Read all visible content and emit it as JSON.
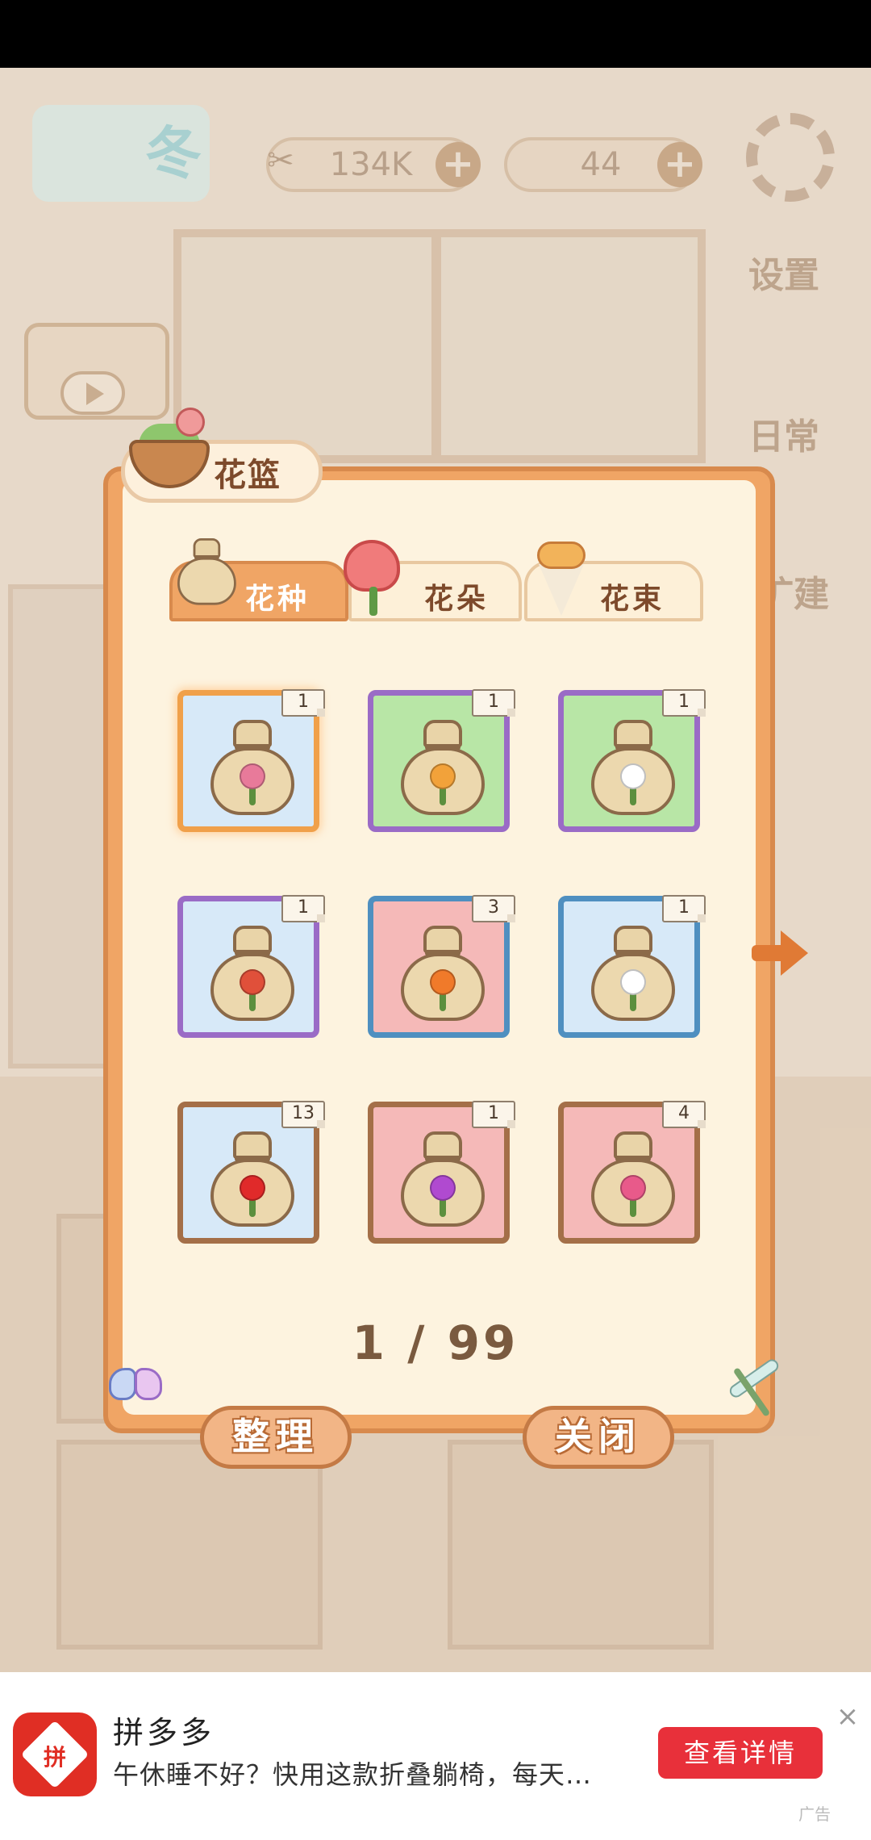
{
  "hud": {
    "season_label": "冬",
    "fish_value": "134K",
    "cheese_value": "44",
    "settings_label": "设置",
    "daily_label": "日常",
    "build_label": "扩建"
  },
  "dialog": {
    "title": "花篮",
    "tabs": [
      {
        "label": "花种",
        "active": true
      },
      {
        "label": "花朵",
        "active": false
      },
      {
        "label": "花束",
        "active": false
      }
    ],
    "slots": [
      {
        "count": "1",
        "frame": "orange",
        "bg": "blue",
        "flower_color": "#e87a9a"
      },
      {
        "count": "1",
        "frame": "purple",
        "bg": "green",
        "flower_color": "#f2a23a"
      },
      {
        "count": "1",
        "frame": "purple",
        "bg": "green",
        "flower_color": "#ffffff"
      },
      {
        "count": "1",
        "frame": "purple",
        "bg": "blue",
        "flower_color": "#e0503a"
      },
      {
        "count": "3",
        "frame": "blue",
        "bg": "pink",
        "flower_color": "#f07a2a"
      },
      {
        "count": "1",
        "frame": "blue",
        "bg": "blue",
        "flower_color": "#ffffff"
      },
      {
        "count": "13",
        "frame": "brown",
        "bg": "blue",
        "flower_color": "#e02a2a"
      },
      {
        "count": "1",
        "frame": "brown",
        "bg": "pink",
        "flower_color": "#b04ad0"
      },
      {
        "count": "4",
        "frame": "brown",
        "bg": "pink",
        "flower_color": "#e85a8a"
      }
    ],
    "pager": "1 / 99",
    "sort_button": "整理",
    "close_button": "关闭"
  },
  "ad": {
    "app_name": "拼多多",
    "logo_text": "拼",
    "description": "午休睡不好？快用这款折叠躺椅，每天…",
    "cta": "查看详情",
    "ad_tag": "广告",
    "close": "×"
  },
  "colors": {
    "panel_orange": "#f0a565",
    "panel_cream": "#fdf3df",
    "ad_red": "#e8303a"
  }
}
